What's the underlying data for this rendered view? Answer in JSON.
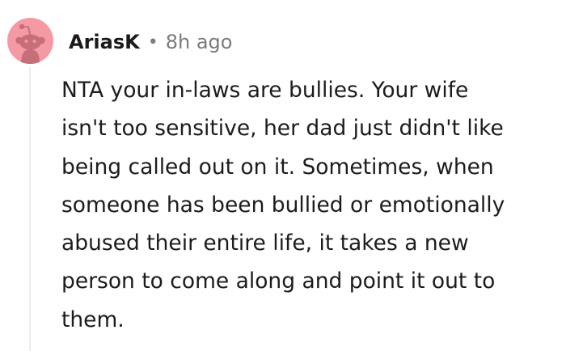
{
  "comment": {
    "author": "AriasK",
    "separator": "•",
    "time_ago": "8h ago",
    "avatar_icon": "snoo-avatar-icon",
    "body_lines": [
      "NTA your in-laws are bullies. Your wife",
      "isn't too sensitive, her dad just didn't like",
      "being called out on it. Sometimes, when",
      "someone has been bullied or emotionally",
      "abused their entire life, it takes a new",
      "person to come along and point it out to",
      "them."
    ]
  },
  "colors": {
    "avatar_background": "#f59aa5",
    "avatar_figure": "#c46f79",
    "thread_line": "#ececec",
    "author_text": "#1a1a1b",
    "meta_text": "#787c7e",
    "body_text": "#1c1c1c"
  }
}
